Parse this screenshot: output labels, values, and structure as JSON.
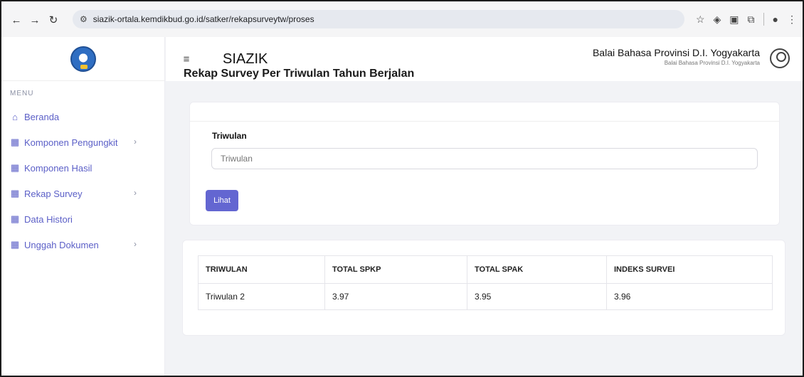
{
  "browser": {
    "url": "siazik-ortala.kemdikbud.go.id/satker/rekapsurveytw/proses"
  },
  "sidebar": {
    "menu_title": "MENU",
    "items": [
      {
        "label": "Beranda",
        "icon": "home-icon"
      },
      {
        "label": "Komponen Pengungkit",
        "icon": "grid-icon",
        "chevron": "›"
      },
      {
        "label": "Komponen Hasil",
        "icon": "grid-icon"
      },
      {
        "label": "Rekap Survey",
        "icon": "grid-icon",
        "chevron": "›"
      },
      {
        "label": "Data Histori",
        "icon": "grid-icon"
      },
      {
        "label": "Unggah Dokumen",
        "icon": "grid-icon",
        "chevron": "›"
      }
    ]
  },
  "header": {
    "app_title": "SIAZIK",
    "user_name": "Balai Bahasa Provinsi D.I. Yogyakarta",
    "user_sub": "Balai Bahasa Provinsi D.I. Yogyakarta"
  },
  "main": {
    "page_title": "Rekap Survey Per Triwulan Tahun Berjalan",
    "form": {
      "label": "Triwulan",
      "placeholder": "Triwulan",
      "button_label": "Lihat"
    },
    "table": {
      "headers": [
        "TRIWULAN",
        "TOTAL SPKP",
        "TOTAL SPAK",
        "INDEKS SURVEI"
      ],
      "rows": [
        [
          "Triwulan 2",
          "3.97",
          "3.95",
          "3.96"
        ]
      ]
    }
  },
  "colors": {
    "accent": "#6366d1",
    "sidebar_text": "#5b5fc7",
    "background": "#f2f3f6"
  }
}
